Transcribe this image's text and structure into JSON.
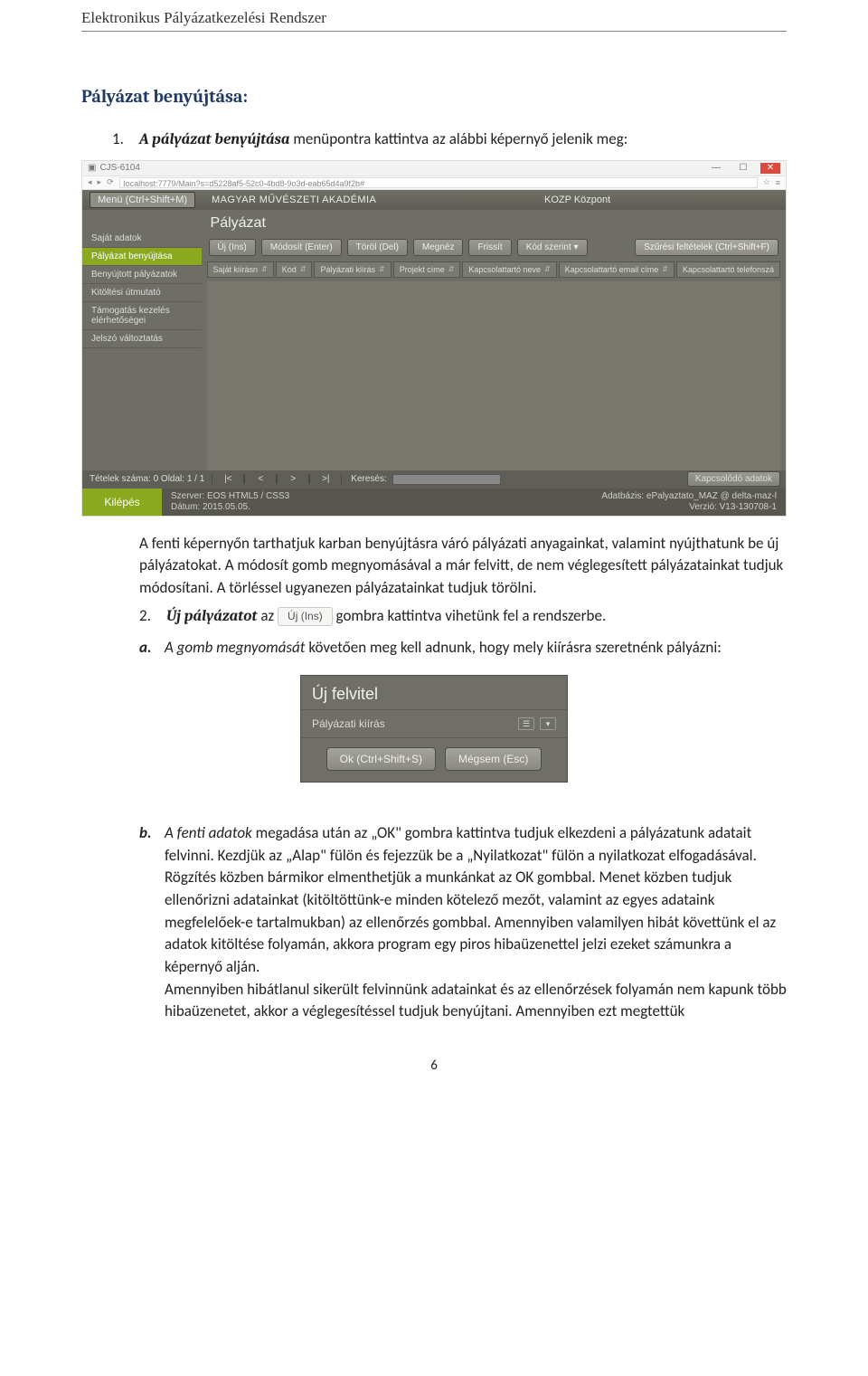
{
  "doc": {
    "header": "Elektronikus Pályázatkezelési Rendszer",
    "section_title": "Pályázat benyújtása:",
    "page_number": "6"
  },
  "para": {
    "n1_num": "1.",
    "n1_lead": "A pályázat benyújtása",
    "n1_rest": " menüpontra kattintva az alábbi képernyő jelenik meg:",
    "after_shot1": "A fenti képernyőn tarthatjuk karban benyújtásra váró pályázati anyagainkat, valamint nyújthatunk be új pályázatokat. A módosít gomb megnyomásával a már felvitt, de nem véglegesített pályázatainkat tudjuk módosítani. A törléssel ugyanezen pályázatainkat tudjuk törölni.",
    "n2_num": "2.",
    "n2_lead": "Új pályázatot",
    "n2_mid": " az ",
    "n2_btn": "Új (Ins)",
    "n2_rest": " gombra kattintva vihetünk fel a rendszerbe.",
    "a_letter": "a.",
    "a_lead": "A gomb megnyomását",
    "a_rest": " követően meg kell adnunk, hogy mely kiírásra szeretnénk pályázni:",
    "b_letter": "b.",
    "b_lead": "A fenti adatok",
    "b_rest": " megadása után az „OK\" gombra kattintva tudjuk elkezdeni a pályázatunk adatait felvinni. Kezdjük az „Alap\" fülön és fejezzük be a „Nyilatkozat\" fülön a nyilatkozat elfogadásával. Rögzítés közben bármikor elmenthetjük a munkánkat az OK gombbal. Menet közben tudjuk ellenőrizni adatainkat (kitöltöttünk-e minden kötelező mezőt, valamint az egyes adataink megfelelőek-e tartalmukban) az ellenőrzés gombbal. Amennyiben valamilyen hibát követtünk el az adatok kitöltése folyamán, akkora program egy piros hibaüzenettel jelzi ezeket számunkra a képernyő alján.\nAmennyiben hibátlanul sikerült felvinnünk adatainkat és az ellenőrzések folyamán nem kapunk több hibaüzenetet, akkor a véglegesítéssel tudjuk benyújtani. Amennyiben ezt megtettük"
  },
  "shot1": {
    "browser_tab": "CJS-6104",
    "url": "localhost:7779/Main?s=d5228af5-52c0-4bd8-9o3d-eab65d4a9f2b#",
    "menu_label": "Menü (Ctrl+Shift+M)",
    "app_title": "MAGYAR MŰVÉSZETI AKADÉMIA",
    "center_label": "KOZP Központ",
    "sidebar": {
      "items": [
        "Saját adatok",
        "Pályázat benyújtása",
        "Benyújtott pályázatok",
        "Kitöltési útmutató",
        "Támogatás kezelés elérhetőségei",
        "Jelszó változtatás"
      ]
    },
    "main_title": "Pályázat",
    "toolbar": [
      "Új (Ins)",
      "Módosít (Enter)",
      "Töröl (Del)",
      "Megnéz",
      "Frissít",
      "Kód szerint ▾"
    ],
    "filter_btn": "Szűrési feltételek (Ctrl+Shift+F)",
    "columns": [
      "Saját kiírásn",
      "Kód",
      "Pályázati kiírás",
      "Projekt címe",
      "Kapcsolattartó neve",
      "Kapcsolattartó email címe",
      "Kapcsolattartó telefonszá"
    ],
    "footer": {
      "count": "Tételek száma: 0 Oldal: 1 / 1",
      "pager": [
        "|<",
        "<",
        ">",
        ">|"
      ],
      "search_label": "Keresés:",
      "related_btn": "Kapcsolódó adatok",
      "exit": "Kilépés",
      "server_label": "Szerver:",
      "server_value": "EOS HTML5 / CSS3",
      "date_label": "Dátum:",
      "date_value": "2015.05.05.",
      "db_label": "Adatbázis:",
      "db_value": "ePalyaztato_MAZ @ delta-maz-l",
      "ver_label": "Verzió:",
      "ver_value": "V13-130708-1"
    }
  },
  "shot2": {
    "title": "Új felvitel",
    "field_label": "Pályázati kiírás",
    "ok": "Ok (Ctrl+Shift+S)",
    "cancel": "Mégsem (Esc)"
  }
}
